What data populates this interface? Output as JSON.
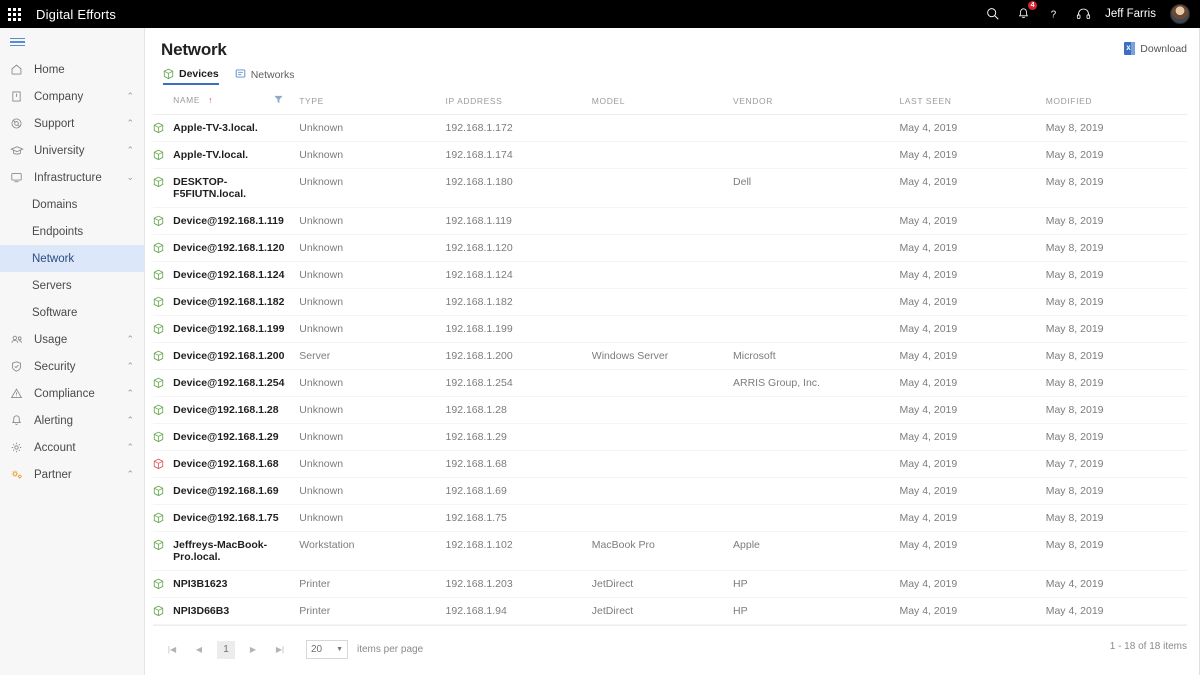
{
  "topbar": {
    "app_grid_icon": "app-grid-icon",
    "brand": "Digital Efforts",
    "search_icon": "search-icon",
    "notifications_icon": "bell-icon",
    "notifications_count": "4",
    "help_icon": "question-mark-icon",
    "support_icon": "headset-icon",
    "username": "Jeff Farris",
    "avatar": "user-avatar"
  },
  "sidebar": {
    "menu_icon": "hamburger-icon",
    "items": [
      {
        "label": "Home",
        "icon": "home-icon",
        "chevron": "",
        "active": false,
        "sub": false
      },
      {
        "label": "Company",
        "icon": "building-icon",
        "chevron": "⌃",
        "active": false,
        "sub": false
      },
      {
        "label": "Support",
        "icon": "lifering-icon",
        "chevron": "⌃",
        "active": false,
        "sub": false
      },
      {
        "label": "University",
        "icon": "graduation-icon",
        "chevron": "⌃",
        "active": false,
        "sub": false
      },
      {
        "label": "Infrastructure",
        "icon": "monitor-icon",
        "chevron": "⌄",
        "active": false,
        "sub": false
      },
      {
        "label": "Domains",
        "icon": "",
        "chevron": "",
        "active": false,
        "sub": true
      },
      {
        "label": "Endpoints",
        "icon": "",
        "chevron": "",
        "active": false,
        "sub": true
      },
      {
        "label": "Network",
        "icon": "",
        "chevron": "",
        "active": true,
        "sub": true
      },
      {
        "label": "Servers",
        "icon": "",
        "chevron": "",
        "active": false,
        "sub": true
      },
      {
        "label": "Software",
        "icon": "",
        "chevron": "",
        "active": false,
        "sub": true
      },
      {
        "label": "Usage",
        "icon": "people-icon",
        "chevron": "⌃",
        "active": false,
        "sub": false
      },
      {
        "label": "Security",
        "icon": "shield-icon",
        "chevron": "⌃",
        "active": false,
        "sub": false
      },
      {
        "label": "Compliance",
        "icon": "warning-icon",
        "chevron": "⌃",
        "active": false,
        "sub": false
      },
      {
        "label": "Alerting",
        "icon": "bell-icon",
        "chevron": "⌃",
        "active": false,
        "sub": false
      },
      {
        "label": "Account",
        "icon": "gear-icon",
        "chevron": "⌃",
        "active": false,
        "sub": false
      },
      {
        "label": "Partner",
        "icon": "gears-icon",
        "chevron": "⌃",
        "active": false,
        "sub": false
      }
    ]
  },
  "page": {
    "title": "Network",
    "download_label": "Download",
    "download_icon": "excel-icon",
    "tabs": [
      {
        "label": "Devices",
        "icon": "cube-icon",
        "active": true
      },
      {
        "label": "Networks",
        "icon": "network-icon",
        "active": false
      }
    ]
  },
  "table": {
    "columns": [
      "NAME",
      "TYPE",
      "IP ADDRESS",
      "MODEL",
      "VENDOR",
      "LAST SEEN",
      "MODIFIED"
    ],
    "sort_column": "NAME",
    "sort_direction_glyph": "↑",
    "filter_icon": "filter-icon",
    "status_colors": {
      "ok": "#6aa84f",
      "alert": "#e05a5a"
    },
    "rows": [
      {
        "status": "ok",
        "name": "Apple-TV-3.local.",
        "type": "Unknown",
        "ip": "192.168.1.172",
        "model": "",
        "vendor": "",
        "last_seen": "May 4, 2019",
        "modified": "May 8, 2019"
      },
      {
        "status": "ok",
        "name": "Apple-TV.local.",
        "type": "Unknown",
        "ip": "192.168.1.174",
        "model": "",
        "vendor": "",
        "last_seen": "May 4, 2019",
        "modified": "May 8, 2019"
      },
      {
        "status": "ok",
        "name": "DESKTOP-F5FIUTN.local.",
        "type": "Unknown",
        "ip": "192.168.1.180",
        "model": "",
        "vendor": "Dell",
        "last_seen": "May 4, 2019",
        "modified": "May 8, 2019"
      },
      {
        "status": "ok",
        "name": "Device@192.168.1.119",
        "type": "Unknown",
        "ip": "192.168.1.119",
        "model": "",
        "vendor": "",
        "last_seen": "May 4, 2019",
        "modified": "May 8, 2019"
      },
      {
        "status": "ok",
        "name": "Device@192.168.1.120",
        "type": "Unknown",
        "ip": "192.168.1.120",
        "model": "",
        "vendor": "",
        "last_seen": "May 4, 2019",
        "modified": "May 8, 2019"
      },
      {
        "status": "ok",
        "name": "Device@192.168.1.124",
        "type": "Unknown",
        "ip": "192.168.1.124",
        "model": "",
        "vendor": "",
        "last_seen": "May 4, 2019",
        "modified": "May 8, 2019"
      },
      {
        "status": "ok",
        "name": "Device@192.168.1.182",
        "type": "Unknown",
        "ip": "192.168.1.182",
        "model": "",
        "vendor": "",
        "last_seen": "May 4, 2019",
        "modified": "May 8, 2019"
      },
      {
        "status": "ok",
        "name": "Device@192.168.1.199",
        "type": "Unknown",
        "ip": "192.168.1.199",
        "model": "",
        "vendor": "",
        "last_seen": "May 4, 2019",
        "modified": "May 8, 2019"
      },
      {
        "status": "ok",
        "name": "Device@192.168.1.200",
        "type": "Server",
        "ip": "192.168.1.200",
        "model": "Windows Server",
        "vendor": "Microsoft",
        "last_seen": "May 4, 2019",
        "modified": "May 8, 2019"
      },
      {
        "status": "ok",
        "name": "Device@192.168.1.254",
        "type": "Unknown",
        "ip": "192.168.1.254",
        "model": "",
        "vendor": "ARRIS Group, Inc.",
        "last_seen": "May 4, 2019",
        "modified": "May 8, 2019"
      },
      {
        "status": "ok",
        "name": "Device@192.168.1.28",
        "type": "Unknown",
        "ip": "192.168.1.28",
        "model": "",
        "vendor": "",
        "last_seen": "May 4, 2019",
        "modified": "May 8, 2019"
      },
      {
        "status": "ok",
        "name": "Device@192.168.1.29",
        "type": "Unknown",
        "ip": "192.168.1.29",
        "model": "",
        "vendor": "",
        "last_seen": "May 4, 2019",
        "modified": "May 8, 2019"
      },
      {
        "status": "alert",
        "name": "Device@192.168.1.68",
        "type": "Unknown",
        "ip": "192.168.1.68",
        "model": "",
        "vendor": "",
        "last_seen": "May 4, 2019",
        "modified": "May 7, 2019"
      },
      {
        "status": "ok",
        "name": "Device@192.168.1.69",
        "type": "Unknown",
        "ip": "192.168.1.69",
        "model": "",
        "vendor": "",
        "last_seen": "May 4, 2019",
        "modified": "May 8, 2019"
      },
      {
        "status": "ok",
        "name": "Device@192.168.1.75",
        "type": "Unknown",
        "ip": "192.168.1.75",
        "model": "",
        "vendor": "",
        "last_seen": "May 4, 2019",
        "modified": "May 8, 2019"
      },
      {
        "status": "ok",
        "name": "Jeffreys-MacBook-Pro.local.",
        "type": "Workstation",
        "ip": "192.168.1.102",
        "model": "MacBook Pro",
        "vendor": "Apple",
        "last_seen": "May 4, 2019",
        "modified": "May 8, 2019"
      },
      {
        "status": "ok",
        "name": "NPI3B1623",
        "type": "Printer",
        "ip": "192.168.1.203",
        "model": "JetDirect",
        "vendor": "HP",
        "last_seen": "May 4, 2019",
        "modified": "May 4, 2019"
      },
      {
        "status": "ok",
        "name": "NPI3D66B3",
        "type": "Printer",
        "ip": "192.168.1.94",
        "model": "JetDirect",
        "vendor": "HP",
        "last_seen": "May 4, 2019",
        "modified": "May 4, 2019"
      }
    ]
  },
  "pager": {
    "first_glyph": "|◀",
    "prev_glyph": "◀",
    "current_page": "1",
    "next_glyph": "▶",
    "last_glyph": "▶|",
    "page_size": "20",
    "caret_glyph": "▼",
    "items_per_page_label": "items per page",
    "range_label": "1 - 18 of 18 items"
  }
}
